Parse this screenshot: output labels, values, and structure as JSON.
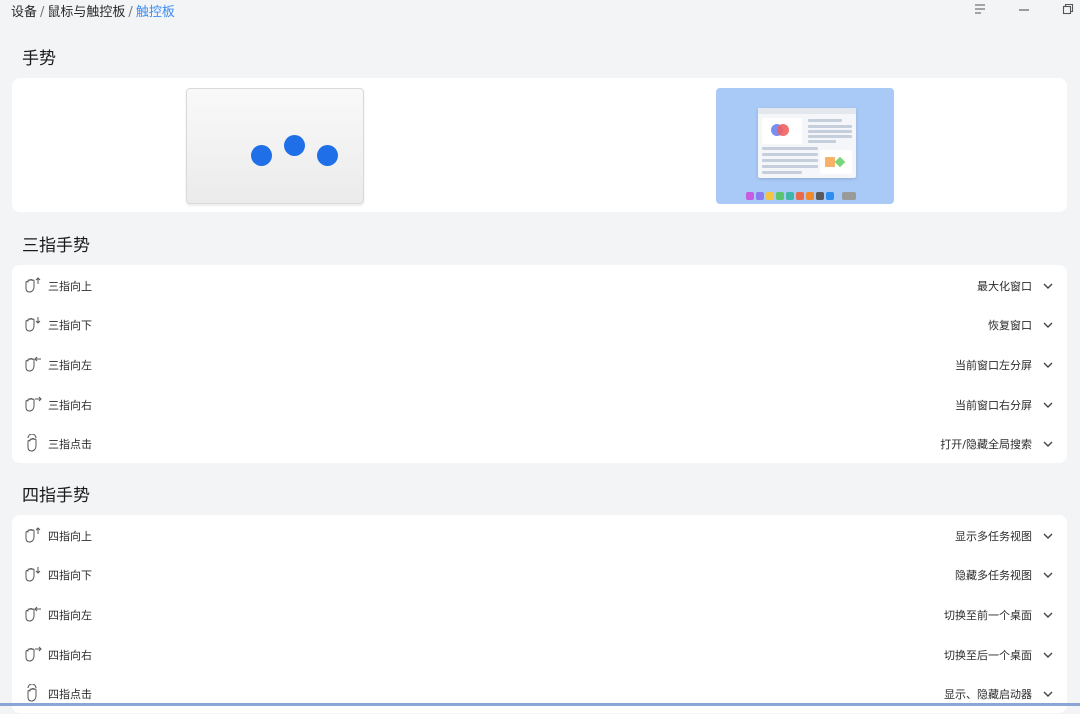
{
  "breadcrumb": {
    "items": [
      "设备",
      "鼠标与触控板"
    ],
    "current": "触控板"
  },
  "window_controls": [
    "menu-icon",
    "minimize-icon",
    "restore-icon"
  ],
  "gestures": {
    "title": "手势"
  },
  "three_finger": {
    "title": "三指手势",
    "rows": [
      {
        "label": "三指向上",
        "value": "最大化窗口",
        "icon": "hand-up-icon"
      },
      {
        "label": "三指向下",
        "value": "恢复窗口",
        "icon": "hand-down-icon"
      },
      {
        "label": "三指向左",
        "value": "当前窗口左分屏",
        "icon": "hand-left-icon"
      },
      {
        "label": "三指向右",
        "value": "当前窗口右分屏",
        "icon": "hand-right-icon"
      },
      {
        "label": "三指点击",
        "value": "打开/隐藏全局搜索",
        "icon": "hand-tap-icon"
      }
    ]
  },
  "four_finger": {
    "title": "四指手势",
    "rows": [
      {
        "label": "四指向上",
        "value": "显示多任务视图",
        "icon": "hand-up-icon"
      },
      {
        "label": "四指向下",
        "value": "隐藏多任务视图",
        "icon": "hand-down-icon"
      },
      {
        "label": "四指向左",
        "value": "切换至前一个桌面",
        "icon": "hand-left-icon"
      },
      {
        "label": "四指向右",
        "value": "切换至后一个桌面",
        "icon": "hand-right-icon"
      },
      {
        "label": "四指点击",
        "value": "显示、隐藏启动器",
        "icon": "hand-tap-icon"
      }
    ]
  },
  "colors": {
    "accent": "#3d8df5",
    "dot": "#1f6fe8"
  }
}
